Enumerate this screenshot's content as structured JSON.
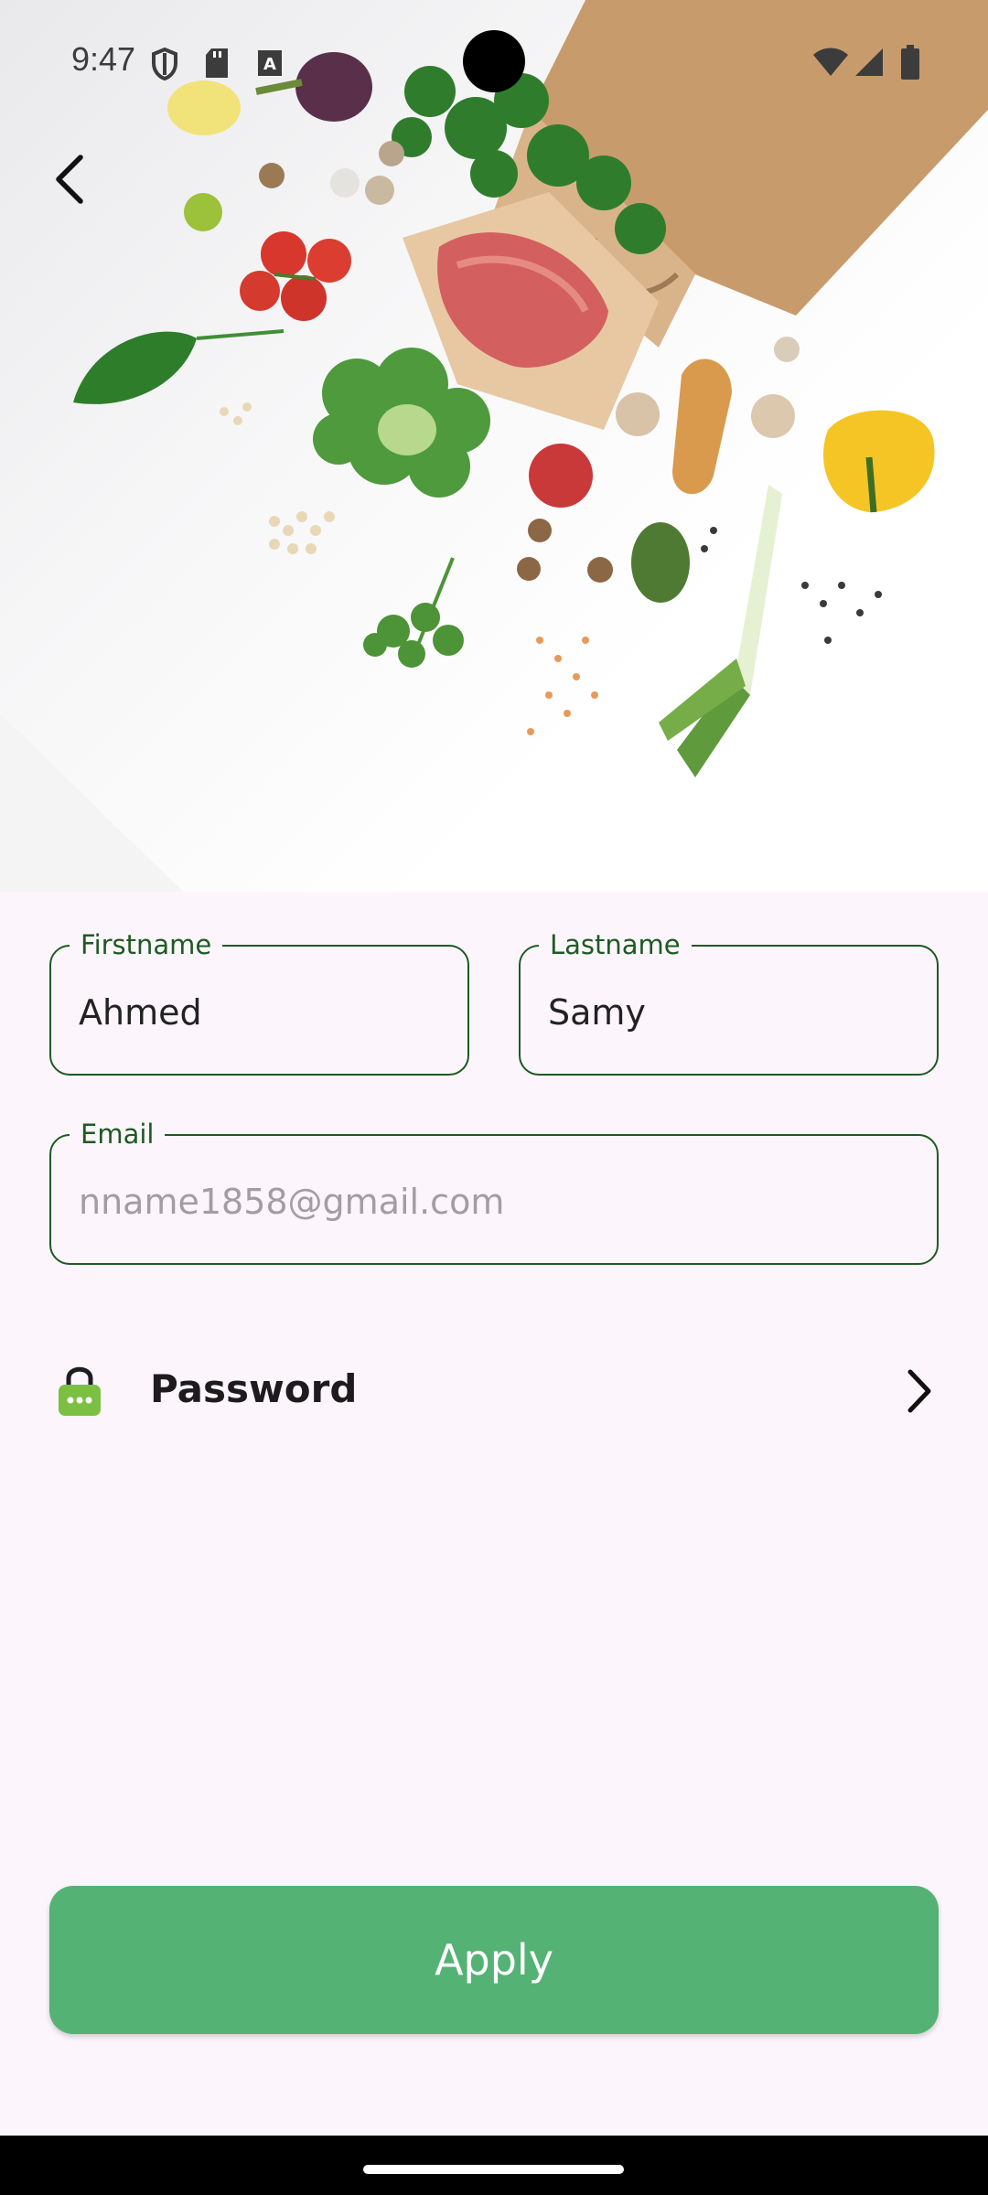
{
  "status_bar": {
    "time": "9:47",
    "icons": [
      "shield-icon",
      "sd-card-icon",
      "font-a-icon",
      "wifi-icon",
      "signal-icon",
      "battery-icon"
    ]
  },
  "hero": {
    "image": "groceries-bag-with-vegetables-photo"
  },
  "navigation": {
    "back_icon": "chevron-left-icon"
  },
  "form": {
    "firstname": {
      "label": "Firstname",
      "value": "Ahmed"
    },
    "lastname": {
      "label": "Lastname",
      "value": "Samy"
    },
    "email": {
      "label": "Email",
      "value": "",
      "placeholder": "nname1858@gmail.com"
    },
    "password": {
      "label": "Password",
      "icon": "lock-icon",
      "chevron": "chevron-right-icon"
    }
  },
  "actions": {
    "apply_label": "Apply"
  },
  "colors": {
    "background": "#fcf6fc",
    "field_border": "#1e5a22",
    "accent": "#54b275",
    "lock_icon": "#7cc043",
    "placeholder": "#a39da3"
  }
}
